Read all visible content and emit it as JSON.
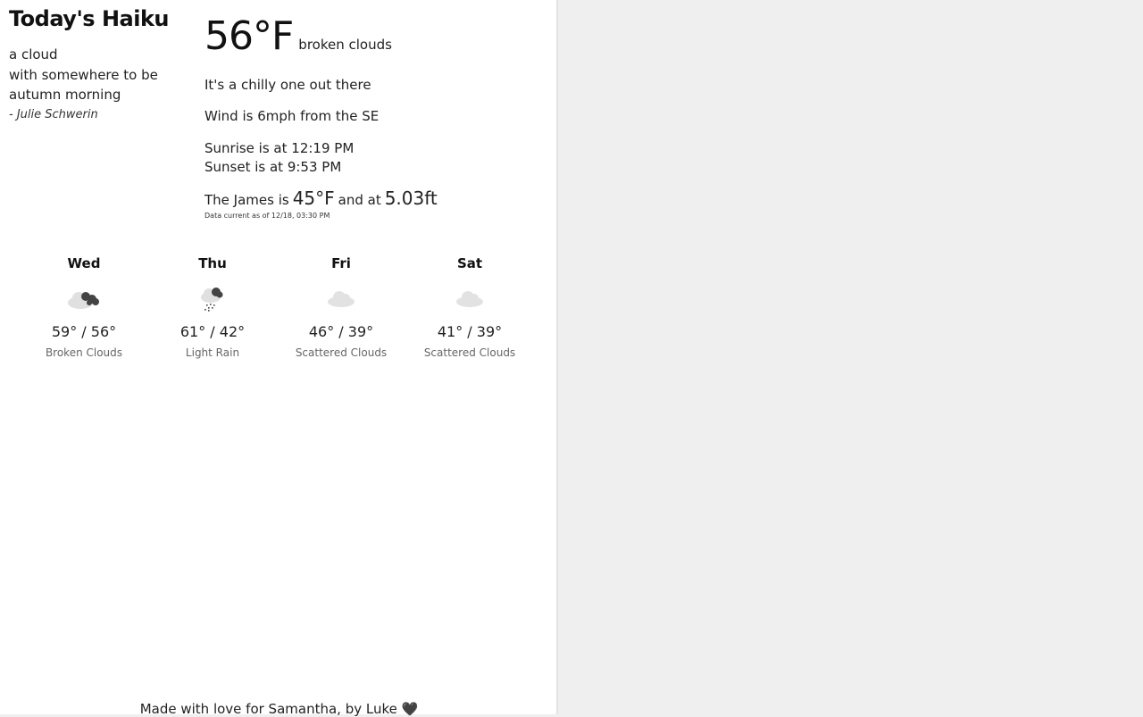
{
  "haiku": {
    "title": "Today's Haiku",
    "lines": [
      "a cloud",
      "with somewhere to be",
      "autumn morning"
    ],
    "author": "- Julie Schwerin"
  },
  "current": {
    "temperature": "56°F",
    "description": "broken clouds",
    "message": "It's a chilly one out there",
    "wind": "Wind is 6mph from the SE",
    "sunrise": "Sunrise is at 12:19  PM",
    "sunset": "Sunset is at 9:53  PM",
    "river_prefix": "The James is",
    "river_temp": "45°F",
    "river_mid": "and at",
    "river_level": "5.03ft",
    "data_current": "Data current as of 12/18, 03:30 PM"
  },
  "forecast": [
    {
      "day": "Wed",
      "temps": "59° / 56°",
      "condition": "Broken Clouds",
      "icon": "broken-clouds-icon"
    },
    {
      "day": "Thu",
      "temps": "61° / 42°",
      "condition": "Light  Rain",
      "icon": "light-rain-icon"
    },
    {
      "day": "Fri",
      "temps": "46° / 39°",
      "condition": "Scattered Clouds",
      "icon": "scattered-clouds-icon"
    },
    {
      "day": "Sat",
      "temps": "41° / 39°",
      "condition": "Scattered Clouds",
      "icon": "scattered-clouds-icon"
    }
  ],
  "footer": "Made with love for Samantha, by Luke 🖤",
  "colors": {
    "background": "#efefef",
    "panel": "#ffffff",
    "cloud_light": "#e0e0e0",
    "cloud_dark": "#444444"
  }
}
